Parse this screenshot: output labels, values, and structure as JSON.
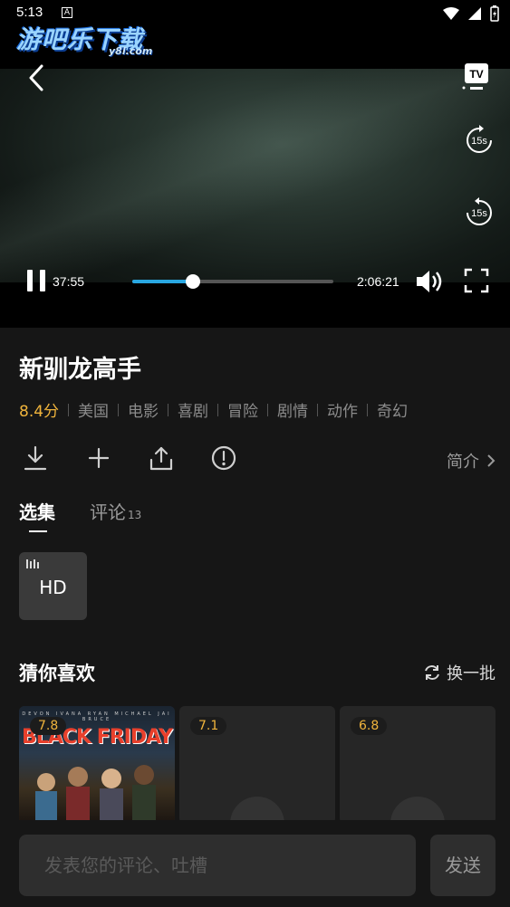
{
  "status_bar": {
    "time": "5:13",
    "notif": "A"
  },
  "watermark": {
    "main": "游吧乐下载",
    "sub": "y8l.com"
  },
  "player": {
    "tv_label": "TV",
    "rewind_label": "15s",
    "forward_label": "15s",
    "current_time": "37:55",
    "total_time": "2:06:21",
    "progress": 0.3,
    "accent_color": "#29a7e1"
  },
  "movie": {
    "title": "新驯龙高手",
    "score": "8.4分",
    "tags": [
      "美国",
      "电影",
      "喜剧",
      "冒险",
      "剧情",
      "动作",
      "奇幻"
    ]
  },
  "actions": {
    "icons": [
      "download-icon",
      "add-icon",
      "share-icon",
      "info-icon"
    ],
    "intro_label": "简介"
  },
  "tabs": {
    "episodes_label": "选集",
    "comments_label": "评论",
    "comments_count": "13"
  },
  "episode": {
    "label": "HD"
  },
  "recommend": {
    "title": "猜你喜欢",
    "refresh_label": "换一批",
    "cards": [
      {
        "rating": "7.8",
        "poster_title": "BLACK FRIDAY",
        "poster_names": "DEVON  IVANA  RYAN  MICHAEL JAI  BRUCE"
      },
      {
        "rating": "7.1"
      },
      {
        "rating": "6.8"
      }
    ]
  },
  "comment": {
    "placeholder": "发表您的评论、吐槽",
    "send_label": "发送"
  }
}
